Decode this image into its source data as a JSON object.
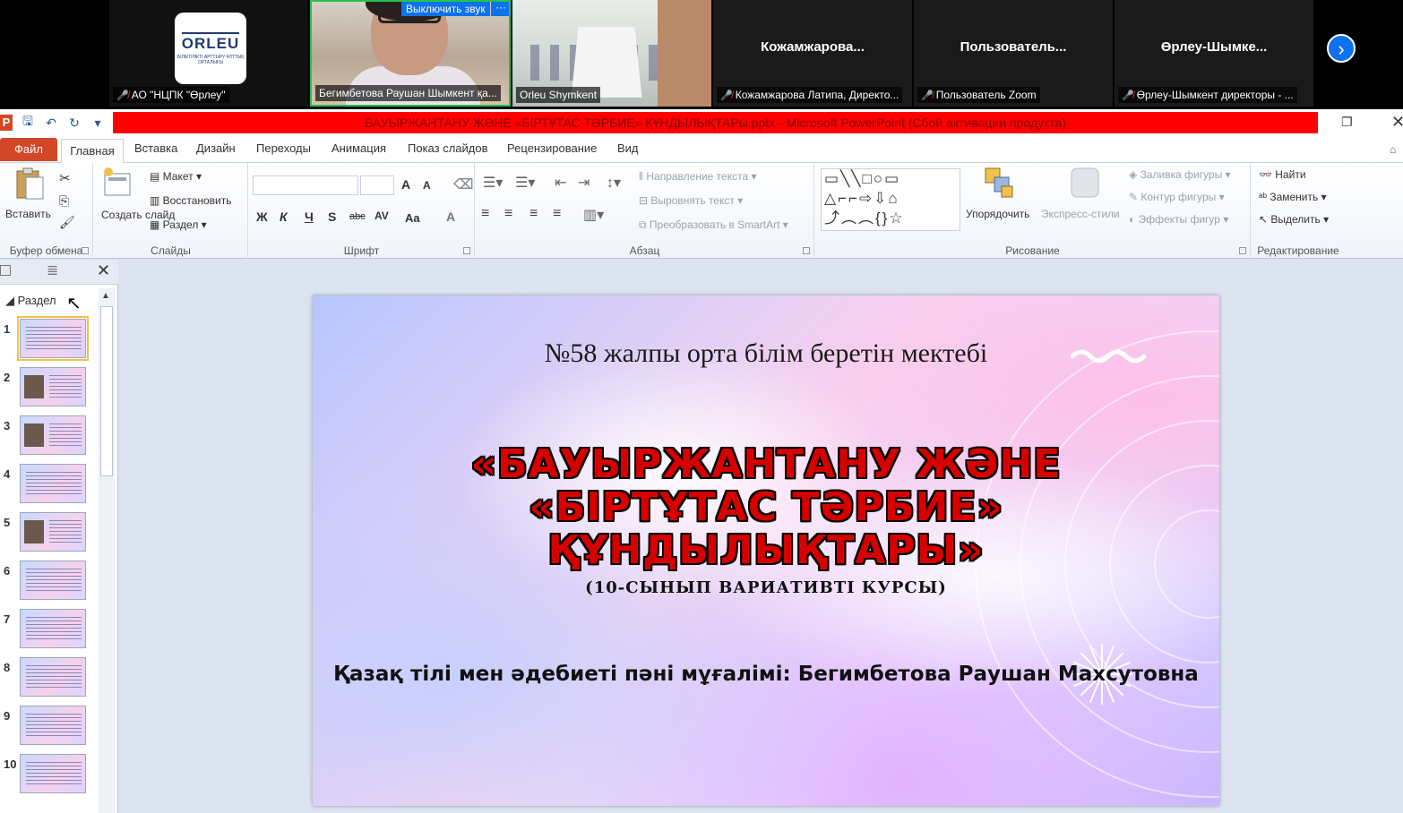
{
  "zoom": {
    "tiles": [
      {
        "id": "orleu",
        "caption": "АО \"НЦПК \"Өрлеу\"",
        "logo_word": "ORLEU",
        "logo_sub": "БІЛІКТІЛІКТІ АРТТЫРУ ҰЛТТЫҚ ОРТАЛЫҒЫ"
      },
      {
        "id": "camera1",
        "caption": "Бегимбетова Раушан Шымкент қа...",
        "mute_label": "Выключить звук",
        "more_label": "···"
      },
      {
        "id": "camera2",
        "caption": "Orleu Shymkent"
      },
      {
        "id": "p4",
        "big_name": "Кожамжарова...",
        "caption": "Кожамжарова Латипа, Директо..."
      },
      {
        "id": "p5",
        "big_name": "Пользователь...",
        "caption": "Пользователь Zoom"
      },
      {
        "id": "p6",
        "big_name": "Өрлеу-Шымке...",
        "caption": "Өрлеу-Шымкент директоры - ..."
      }
    ],
    "next_icon": "chevron-right-icon"
  },
  "ppt": {
    "window_title": "БАУЫРЖАНТАНУ ЖӘНЕ «БІРТҰТАС ТӘРБИЕ» ҚҰНДЫЛЫҚТАРы.pptx  -  Microsoft PowerPoint (Сбой активации продукта)",
    "tabs": [
      "Файл",
      "Главная",
      "Вставка",
      "Дизайн",
      "Переходы",
      "Анимация",
      "Показ слайдов",
      "Рецензирование",
      "Вид"
    ],
    "ribbon": {
      "clipboard": {
        "label": "Буфер обмена",
        "paste": "Вставить"
      },
      "slides": {
        "label": "Слайды",
        "new_slide": "Создать слайд",
        "layout": "Макет",
        "reset": "Восстановить",
        "section": "Раздел"
      },
      "font": {
        "label": "Шрифт",
        "bold": "Ж",
        "italic": "К",
        "underline": "Ч",
        "shadow": "S",
        "strike": "abc",
        "spacing": "AV",
        "case": "Aa",
        "grow": "A",
        "shrink": "A",
        "color": "A"
      },
      "paragraph": {
        "label": "Абзац",
        "text_direction": "Направление текста",
        "align_text": "Выровнять текст",
        "smartart": "Преобразовать в SmartArt"
      },
      "drawing": {
        "label": "Рисование",
        "arrange": "Упорядочить",
        "quick_styles": "Экспресс-стили",
        "fill": "Заливка фигуры",
        "outline": "Контур фигуры",
        "effects": "Эффекты фигур"
      },
      "editing": {
        "label": "Редактирование",
        "find": "Найти",
        "replace": "Заменить",
        "select": "Выделить"
      }
    },
    "pane": {
      "section_label": "Раздел",
      "slides": [
        "1",
        "2",
        "3",
        "4",
        "5",
        "6",
        "7",
        "8",
        "9",
        "10"
      ],
      "selected_slide": "1"
    },
    "slide": {
      "subtitle": "№58 жалпы орта білім беретін мектебі",
      "title_lines": [
        "«БАУЫРЖАНТАНУ ЖӘНЕ",
        "«БІРТҰТАС ТӘРБИЕ»",
        "ҚҰНДЫЛЫҚТАРЫ»"
      ],
      "course": "(10-СЫНЫП ВАРИАТИВТІ КУРСЫ)",
      "teacher": "Қазақ тілі мен әдебиеті пәні мұғалімі: Бегимбетова Раушан Махсутовна"
    }
  }
}
